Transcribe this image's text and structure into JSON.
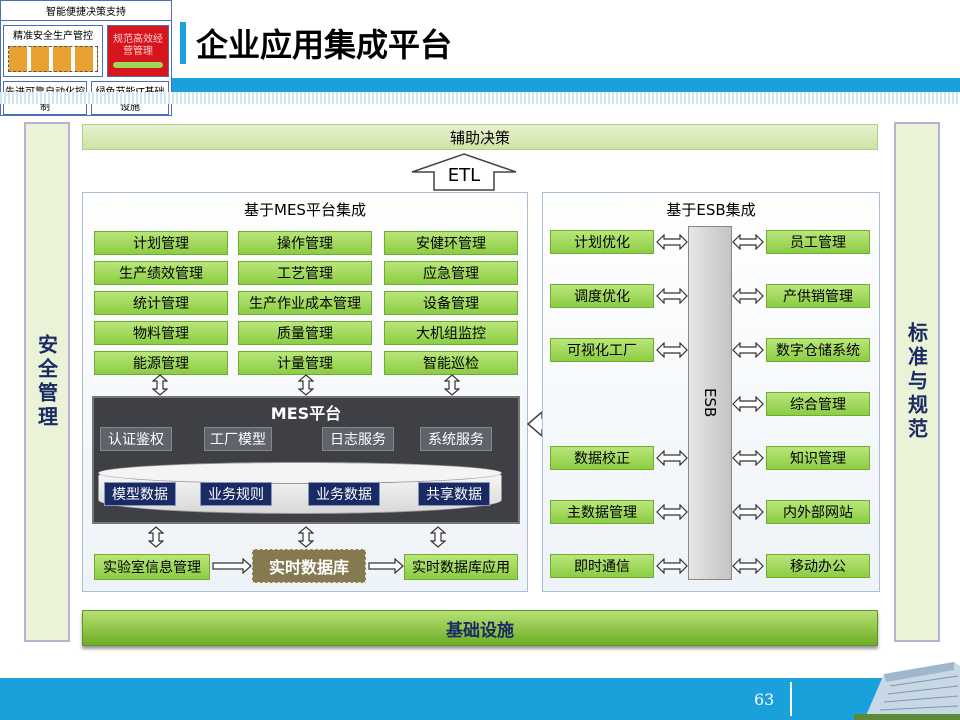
{
  "thumbnail": {
    "top_label": "智能便捷决策支持",
    "left_label": "精准安全生产管控",
    "red_label": "规范高效经营管理",
    "bottom_left": "先进可靠自动化控制",
    "bottom_right": "绿色节能IT基础设施"
  },
  "title": "企业应用集成平台",
  "left_pillar": "安全管理",
  "right_pillar": "标准与规范",
  "top_bar": "辅助决策",
  "etl": "ETL",
  "mes": {
    "section_title": "基于MES平台集成",
    "modules": [
      "计划管理",
      "操作管理",
      "安健环管理",
      "生产绩效管理",
      "工艺管理",
      "应急管理",
      "统计管理",
      "生产作业成本管理",
      "设备管理",
      "物料管理",
      "质量管理",
      "大机组监控",
      "能源管理",
      "计量管理",
      "智能巡检"
    ],
    "platform_title": "MES平台",
    "services": [
      "认证鉴权",
      "工厂模型",
      "日志服务",
      "系统服务"
    ],
    "data_items": [
      "模型数据",
      "业务规则",
      "业务数据",
      "共享数据"
    ],
    "lims": "实验室信息管理",
    "rtdb": "实时数据库",
    "rtdb_app": "实时数据库应用"
  },
  "esb": {
    "section_title": "基于ESB集成",
    "bus": "ESB",
    "left_items": [
      "计划优化",
      "调度优化",
      "可视化工厂",
      "数据校正",
      "主数据管理",
      "即时通信"
    ],
    "right_items": [
      "员工管理",
      "产供销管理",
      "数字仓储系统",
      "综合管理",
      "知识管理",
      "内外部网站",
      "移动办公"
    ]
  },
  "bottom_bar": "基础设施",
  "page_number": "63",
  "colors": {
    "accent_blue": "#1aa1dc",
    "module_green": "#9bd85a",
    "mes_dark": "#3e4046",
    "thumb_red": "#d8141c"
  }
}
